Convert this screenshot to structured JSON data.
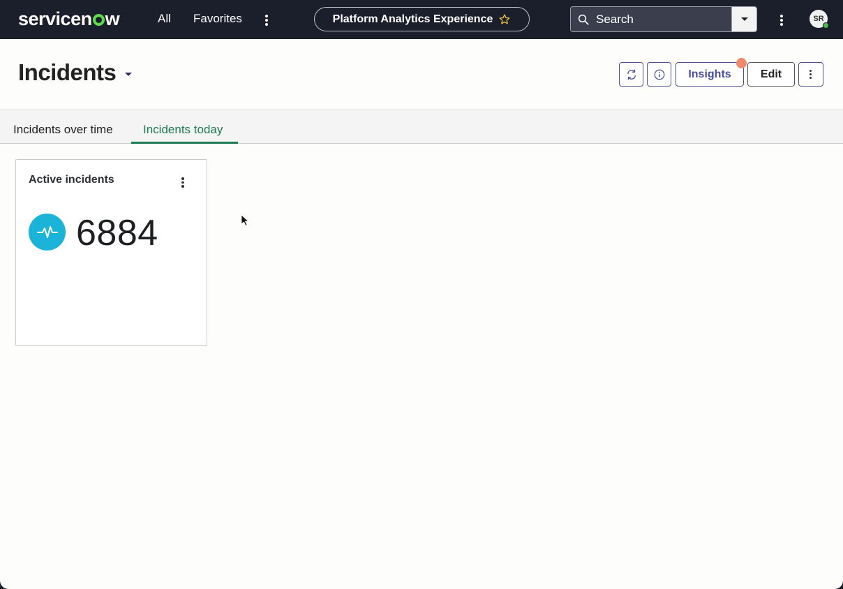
{
  "topnav": {
    "logo_prefix": "servicen",
    "logo_suffix": "w",
    "all_label": "All",
    "favorites_label": "Favorites",
    "context_pill_label": "Platform Analytics Experience",
    "search_placeholder": "Search",
    "avatar_initials": "SR",
    "colors": {
      "background": "#1b1e2b",
      "logo_accent": "#62d84e",
      "presence": "#4aba48"
    }
  },
  "header": {
    "title": "Incidents",
    "insights_label": "Insights",
    "edit_label": "Edit",
    "icons": [
      "refresh-icon",
      "info-icon",
      "more-vertical-icon"
    ]
  },
  "tabs": [
    {
      "label": "Incidents over time",
      "selected": false
    },
    {
      "label": "Incidents today",
      "selected": true
    }
  ],
  "card": {
    "title": "Active incidents",
    "value": "6884",
    "icon": "pulse-icon",
    "icon_color": "#1bb4d8"
  },
  "accent_color": "#1d7a55"
}
